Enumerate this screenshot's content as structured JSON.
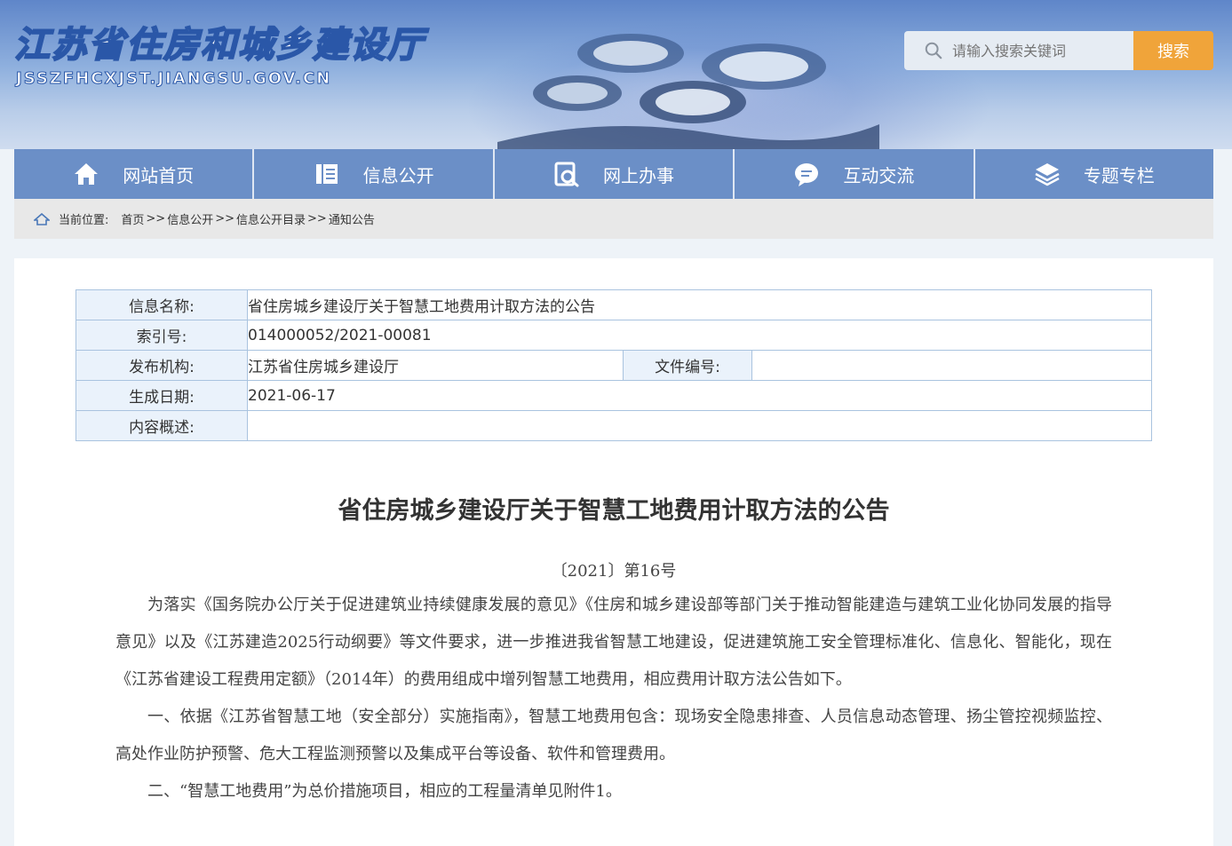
{
  "header": {
    "site_title": "江苏省住房和城乡建设厅",
    "site_domain": "JSSZFHCXJST.JIANGSU.GOV.CN",
    "search_placeholder": "请输入搜索关键词",
    "search_button": "搜索",
    "search_button_color": "#f0a43a"
  },
  "nav": {
    "bg_color": "#6b8fc7",
    "items": [
      {
        "label": "网站首页",
        "icon": "home-icon"
      },
      {
        "label": "信息公开",
        "icon": "document-icon"
      },
      {
        "label": "网上办事",
        "icon": "service-search-icon"
      },
      {
        "label": "互动交流",
        "icon": "chat-icon"
      },
      {
        "label": "专题专栏",
        "icon": "layers-icon"
      }
    ]
  },
  "breadcrumb": {
    "label": "当前位置:",
    "items": [
      "首页",
      "信息公开",
      "信息公开目录",
      "通知公告"
    ],
    "separator": ">>"
  },
  "meta": {
    "name_label": "信息名称:",
    "name_value": "省住房城乡建设厅关于智慧工地费用计取方法的公告",
    "index_label": "索引号:",
    "index_value": "014000052/2021-00081",
    "org_label": "发布机构:",
    "org_value": "江苏省住房城乡建设厅",
    "file_no_label": "文件编号:",
    "file_no_value": "",
    "date_label": "生成日期:",
    "date_value": "2021-06-17",
    "summary_label": "内容概述:",
    "summary_value": ""
  },
  "article": {
    "title": "省住房城乡建设厅关于智慧工地费用计取方法的公告",
    "doc_number": "〔2021〕第16号",
    "paragraphs": [
      "为落实《国务院办公厅关于促进建筑业持续健康发展的意见》《住房和城乡建设部等部门关于推动智能建造与建筑工业化协同发展的指导意见》以及《江苏建造2025行动纲要》等文件要求，进一步推进我省智慧工地建设，促进建筑施工安全管理标准化、信息化、智能化，现在《江苏省建设工程费用定额》（2014年）的费用组成中增列智慧工地费用，相应费用计取方法公告如下。",
      "一、依据《江苏省智慧工地（安全部分）实施指南》，智慧工地费用包含：现场安全隐患排查、人员信息动态管理、扬尘管控视频监控、高处作业防护预警、危大工程监测预警以及集成平台等设备、软件和管理费用。",
      "二、“智慧工地费用”为总价措施项目，相应的工程量清单见附件1。"
    ]
  }
}
